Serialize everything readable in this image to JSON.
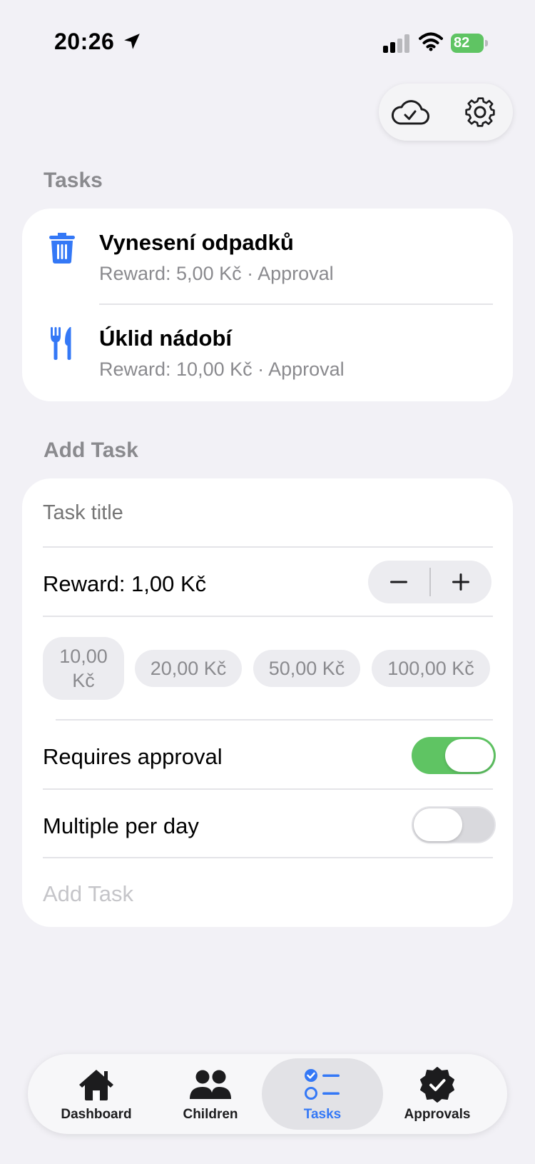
{
  "status_bar": {
    "time": "20:26",
    "battery": "82"
  },
  "sections": {
    "tasks_header": "Tasks",
    "add_task_header": "Add Task"
  },
  "tasks": [
    {
      "title": "Vynesení odpadků",
      "subtitle": "Reward: 5,00 Kč · Approval",
      "icon": "trash-icon"
    },
    {
      "title": "Úklid nádobí",
      "subtitle": "Reward: 10,00 Kč · Approval",
      "icon": "fork-knife-icon"
    }
  ],
  "add_task": {
    "title_placeholder": "Task title",
    "reward_label": "Reward: 1,00 Kč",
    "stepper": {
      "minus": "−",
      "plus": "+"
    },
    "quick_amounts": [
      "10,00 Kč",
      "20,00 Kč",
      "50,00 Kč",
      "100,00 Kč"
    ],
    "requires_approval_label": "Requires approval",
    "requires_approval": true,
    "multiple_per_day_label": "Multiple per day",
    "multiple_per_day": false,
    "submit_label": "Add Task"
  },
  "tab_bar": {
    "active": "Tasks",
    "tabs": [
      {
        "label": "Dashboard",
        "icon": "house-icon"
      },
      {
        "label": "Children",
        "icon": "people-icon"
      },
      {
        "label": "Tasks",
        "icon": "checklist-icon"
      },
      {
        "label": "Approvals",
        "icon": "checkmark-seal-icon"
      }
    ]
  },
  "colors": {
    "accent": "#3478f6",
    "toggle_on": "#5fc463",
    "background": "#f2f1f6"
  }
}
